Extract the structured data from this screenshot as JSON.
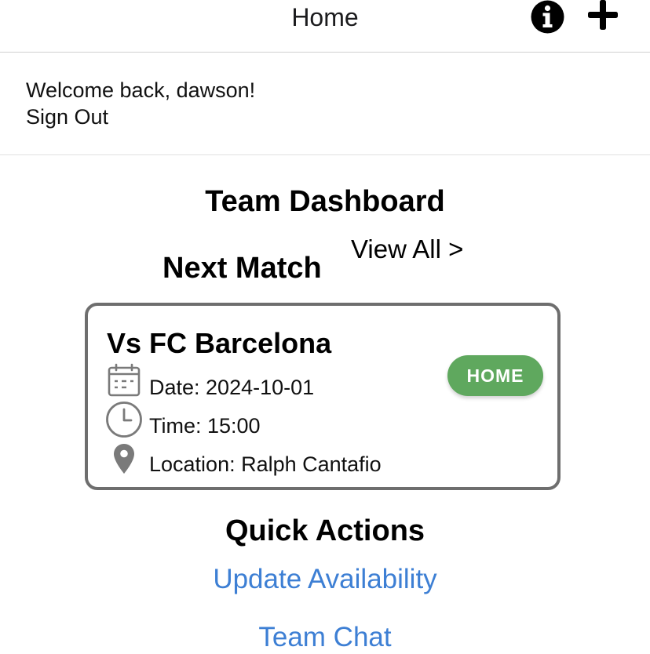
{
  "header": {
    "title": "Home",
    "icons": [
      "info-circle-icon",
      "plus-icon"
    ]
  },
  "welcome": {
    "greeting": "Welcome back, dawson!",
    "sign_out_label": "Sign Out"
  },
  "dashboard": {
    "title": "Team Dashboard",
    "next_match_label": "Next Match",
    "view_all_label": "View All >"
  },
  "match": {
    "opponent": "Vs FC Barcelona",
    "badge": "HOME",
    "date": "Date: 2024-10-01",
    "time": "Time: 15:00",
    "location": "Location: Ralph Cantafio",
    "icons": [
      "calendar-icon",
      "clock-icon",
      "location-pin-icon"
    ]
  },
  "quick_actions": {
    "title": "Quick Actions",
    "items": [
      {
        "label": "Update Availability"
      },
      {
        "label": "Team Chat"
      }
    ]
  },
  "colors": {
    "accent_link": "#3d7fd4",
    "home_badge": "#5fa85e",
    "card_border": "#6e6e6e",
    "icon_gray": "#7a7a7a"
  }
}
